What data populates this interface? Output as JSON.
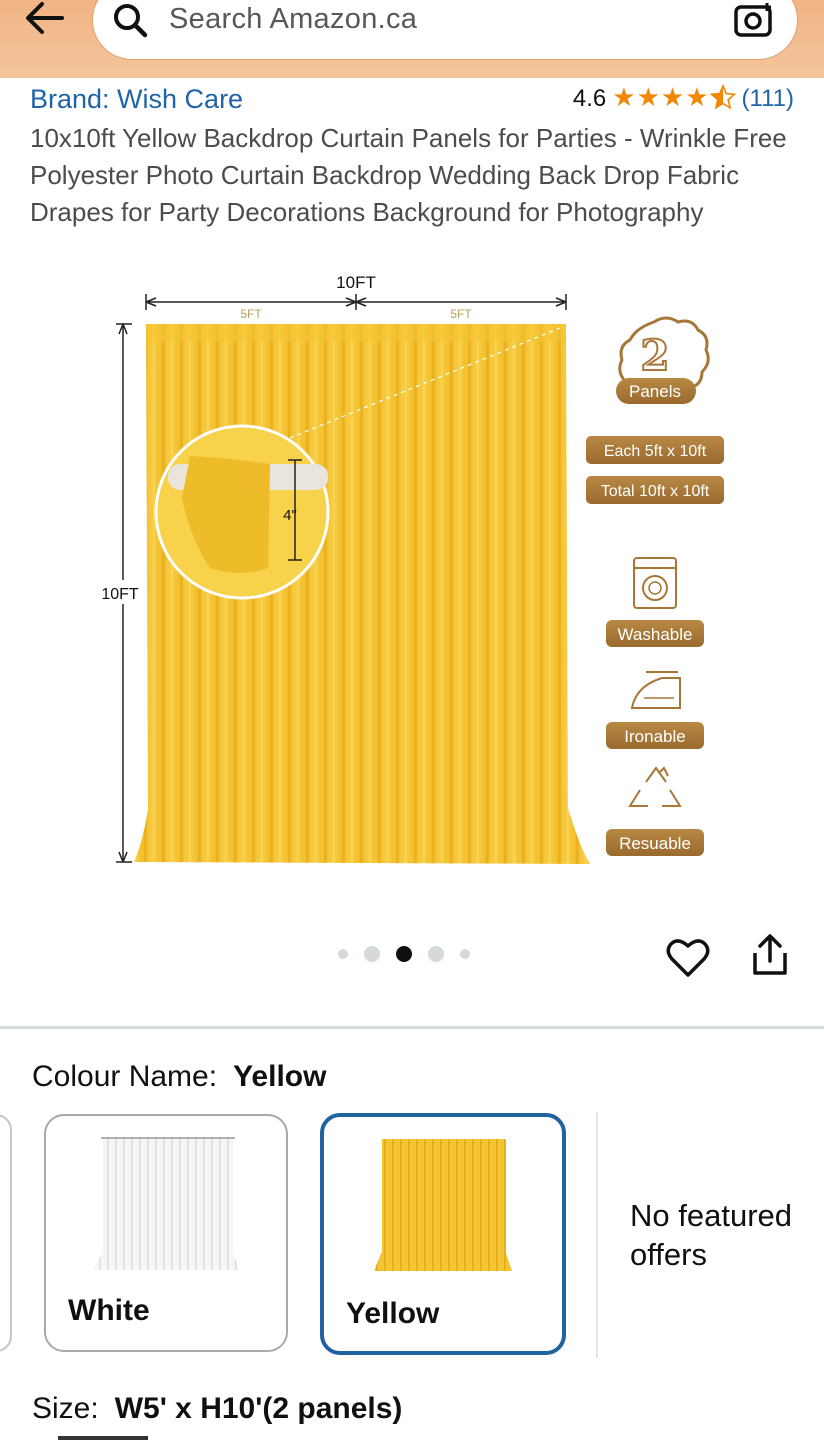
{
  "header": {
    "search_placeholder": "Search Amazon.ca"
  },
  "product": {
    "brand": "Brand: Wish Care",
    "rating": "4.6",
    "stars": 4.5,
    "review_count": "(111)",
    "title": "10x10ft Yellow Backdrop Curtain Panels for Parties - Wrinkle Free Polyester Photo Curtain Backdrop Wedding Back Drop Fabric Drapes for Party Decorations Background for Photography"
  },
  "image": {
    "width_label": "10FT",
    "half_label_left": "5FT",
    "half_label_right": "5FT",
    "height_label": "10FT",
    "rod_label": "4\"",
    "panels_number": "2",
    "panels_label": "Panels",
    "each_size": "Each 5ft x 10ft",
    "total_size": "Total 10ft x 10ft",
    "feature_washable": "Washable",
    "feature_ironable": "Ironable",
    "feature_reusable": "Resuable"
  },
  "carousel": {
    "count": 5,
    "active_index": 2
  },
  "colour": {
    "label": "Colour Name:",
    "value": "Yellow",
    "options": [
      {
        "label": "White"
      },
      {
        "label": "Yellow"
      }
    ],
    "no_offers": "No featured offers"
  },
  "size": {
    "label": "Size:",
    "value": "W5' x H10'(2 panels)"
  },
  "colors": {
    "header_bg": "#f3bd92",
    "link": "#1f64a8",
    "star": "#f08804",
    "selected_border": "#2162a1",
    "curtain": "#f5c433",
    "badge": "#a77739"
  }
}
